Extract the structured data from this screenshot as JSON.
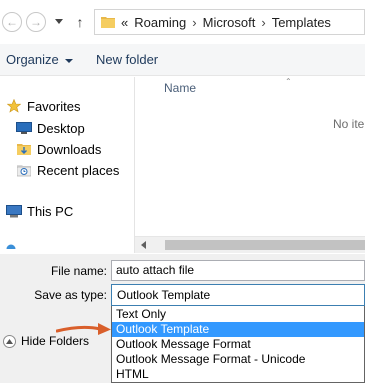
{
  "address": {
    "overflow": "«",
    "crumbs": [
      "Roaming",
      "Microsoft",
      "Templates"
    ],
    "separator": "›"
  },
  "toolbar": {
    "organize_label": "Organize",
    "new_folder_label": "New folder"
  },
  "nav": {
    "favorites_label": "Favorites",
    "items": [
      {
        "label": "Desktop",
        "icon": "desktop-icon"
      },
      {
        "label": "Downloads",
        "icon": "downloads-icon"
      },
      {
        "label": "Recent places",
        "icon": "recent-places-icon"
      }
    ],
    "this_pc_label": "This PC"
  },
  "list": {
    "col_name": "Name",
    "empty_text": "No ite"
  },
  "form": {
    "file_name_label": "File name:",
    "file_name_value": "auto attach file",
    "save_type_label": "Save as type:",
    "save_type_value": "Outlook Template"
  },
  "hide_folders_label": "Hide Folders",
  "dropdown": {
    "options": [
      "Text Only",
      "Outlook Template",
      "Outlook Message Format",
      "Outlook Message Format - Unicode",
      "HTML"
    ],
    "selected_index": 1
  },
  "colors": {
    "selection": "#3399ff",
    "annotation_arrow": "#d95f2b",
    "folder_yellow": "#e8b84a"
  }
}
